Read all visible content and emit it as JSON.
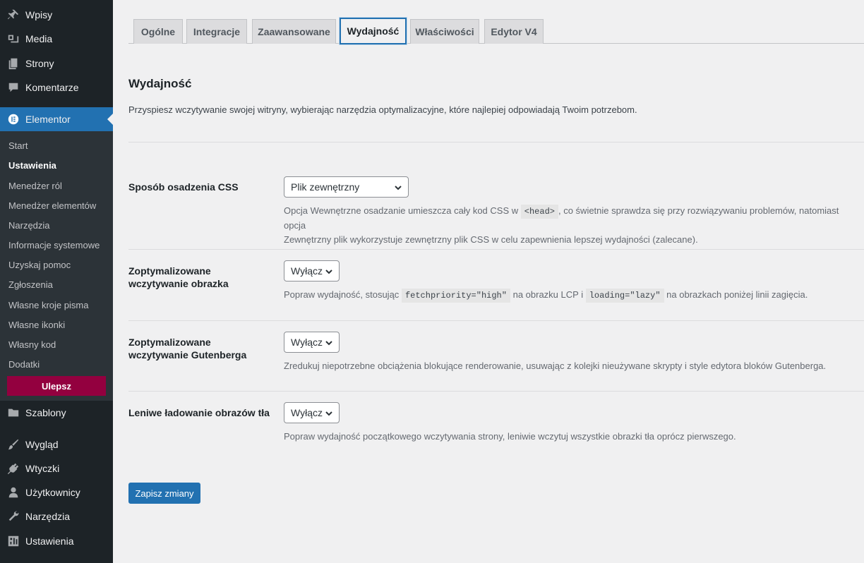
{
  "sidebar": {
    "top_items": [
      {
        "label": "Wpisy",
        "icon": "pin-icon"
      },
      {
        "label": "Media",
        "icon": "media-icon"
      },
      {
        "label": "Strony",
        "icon": "pages-icon"
      },
      {
        "label": "Komentarze",
        "icon": "comments-icon"
      }
    ],
    "active_item": {
      "label": "Elementor",
      "icon": "elementor-icon"
    },
    "submenu": [
      {
        "label": "Start"
      },
      {
        "label": "Ustawienia"
      },
      {
        "label": "Menedżer ról"
      },
      {
        "label": "Menedżer elementów"
      },
      {
        "label": "Narzędzia"
      },
      {
        "label": "Informacje systemowe"
      },
      {
        "label": "Uzyskaj pomoc"
      },
      {
        "label": "Zgłoszenia"
      },
      {
        "label": "Własne kroje pisma"
      },
      {
        "label": "Własne ikonki"
      },
      {
        "label": "Własny kod"
      },
      {
        "label": "Dodatki"
      }
    ],
    "upgrade_label": "Ulepsz",
    "bottom_items": [
      {
        "label": "Szablony",
        "icon": "folder-icon"
      },
      {
        "label": "Wygląd",
        "icon": "brush-icon"
      },
      {
        "label": "Wtyczki",
        "icon": "plugin-icon"
      },
      {
        "label": "Użytkownicy",
        "icon": "user-icon"
      },
      {
        "label": "Narzędzia",
        "icon": "wrench-icon"
      },
      {
        "label": "Ustawienia",
        "icon": "settings-icon"
      }
    ]
  },
  "tabs": [
    {
      "label": "Ogólne"
    },
    {
      "label": "Integracje"
    },
    {
      "label": "Zaawansowane"
    },
    {
      "label": "Wydajność"
    },
    {
      "label": "Właściwości"
    },
    {
      "label": "Edytor V4"
    }
  ],
  "active_tab": "Wydajność",
  "section": {
    "title": "Wydajność",
    "description": "Przyspiesz wczytywanie swojej witryny, wybierając narzędzia optymalizacyjne, które najlepiej odpowiadają Twoim potrzebom."
  },
  "fields": {
    "css": {
      "label": "Sposób osadzenia CSS",
      "value": "Plik zewnętrzny",
      "desc_1": "Opcja Wewnętrzne osadzanie umieszcza cały kod CSS w",
      "code": "<head>",
      "desc_2": ", co świetnie sprawdza się przy rozwiązywaniu problemów, natomiast opcja",
      "desc_3": "Zewnętrzny plik wykorzystuje zewnętrzny plik CSS w celu zapewnienia lepszej wydajności (zalecane)."
    },
    "image": {
      "label": "Zoptymalizowane wczytywanie obrazka",
      "value": "Wyłącz",
      "desc_1": "Popraw wydajność, stosując",
      "code_1": "fetchpriority=\"high\"",
      "desc_2": "na obrazku LCP i",
      "code_2": "loading=\"lazy\"",
      "desc_3": "na obrazkach poniżej linii zagięcia."
    },
    "gutenberg": {
      "label": "Zoptymalizowane wczytywanie Gutenberga",
      "value": "Wyłącz",
      "desc": "Zredukuj niepotrzebne obciążenia blokujące renderowanie, usuwając z kolejki nieużywane skrypty i style edytora bloków Gutenberga."
    },
    "bg": {
      "label": "Leniwe ładowanie obrazów tła",
      "value": "Wyłącz",
      "desc": "Popraw wydajność początkowego wczytywania strony, leniwie wczytuj wszystkie obrazki tła oprócz pierwszego."
    }
  },
  "save_label": "Zapisz zmiany"
}
